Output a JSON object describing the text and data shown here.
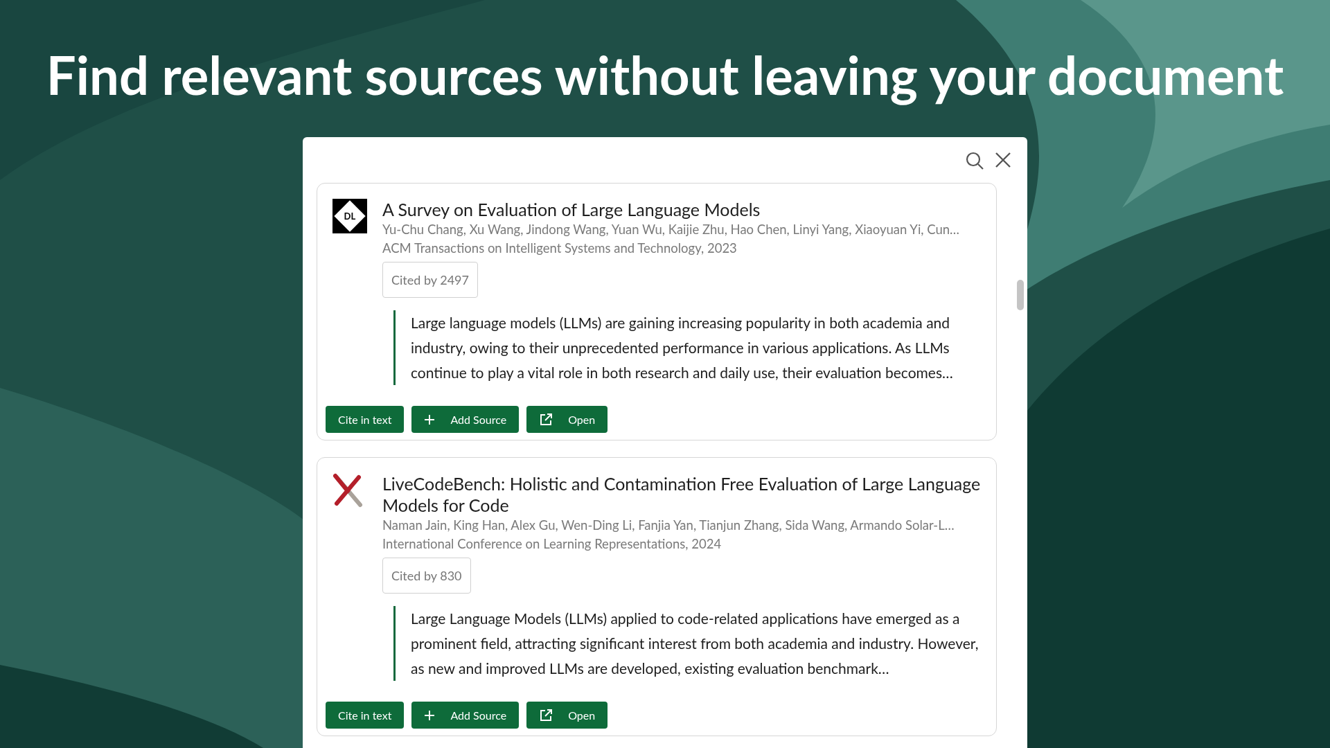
{
  "headline": "Find relevant sources without leaving your document",
  "results": [
    {
      "logo": {
        "kind": "badge",
        "text": "DL"
      },
      "title": "A Survey on Evaluation of Large Language Models",
      "authors": "Yu-Chu Chang, Xu Wang, Jindong Wang, Yuan Wu, Kaijie Zhu, Hao Chen, Linyi Yang, Xiaoyuan Yi, Cun…",
      "venue": "ACM Transactions on Intelligent Systems and Technology, 2023",
      "citations": "Cited by 2497",
      "abstract": "Large language models (LLMs) are gaining increasing popularity in both academia and industry, owing to their unprecedented performance in various applications. As LLMs continue to play a vital role in both research and daily use, their evaluation becomes…",
      "buttons": [
        {
          "kind": "cite",
          "label": "Cite in text"
        },
        {
          "kind": "add",
          "label": "Add Source"
        },
        {
          "kind": "open",
          "label": "Open"
        }
      ]
    },
    {
      "logo": {
        "kind": "cross"
      },
      "title": "LiveCodeBench: Holistic and Contamination Free Evaluation of Large Language Models for Code",
      "authors": "Naman Jain, King Han, Alex Gu, Wen-Ding Li, Fanjia Yan, Tianjun Zhang, Sida Wang, Armando Solar-L…",
      "venue": "International Conference on Learning Representations, 2024",
      "citations": "Cited by 830",
      "abstract": "Large Language Models (LLMs) applied to code-related applications have emerged as a prominent field, attracting significant interest from both academia and industry. However, as new and improved LLMs are developed, existing evaluation benchmark…",
      "buttons": [
        {
          "kind": "cite",
          "label": "Cite in text"
        },
        {
          "kind": "add",
          "label": "Add Source"
        },
        {
          "kind": "open",
          "label": "Open"
        }
      ]
    }
  ]
}
